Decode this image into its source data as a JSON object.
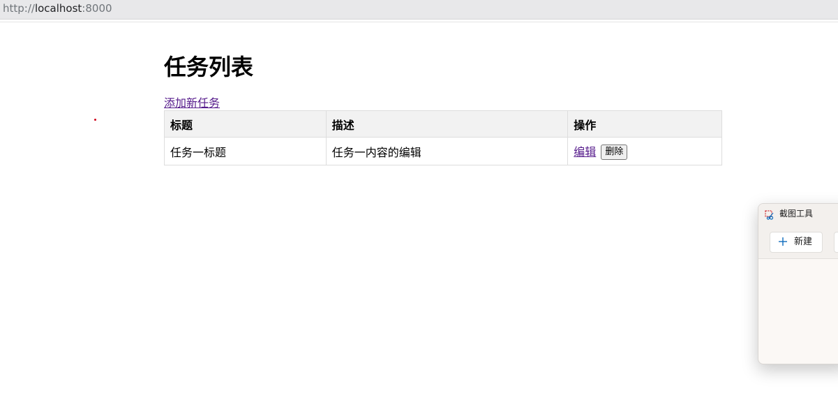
{
  "browser": {
    "url_scheme": "http://",
    "url_host": "localhost",
    "url_port": ":8000"
  },
  "page": {
    "title": "任务列表",
    "add_link": "添加新任务",
    "table": {
      "headers": [
        "标题",
        "描述",
        "操作"
      ],
      "rows": [
        {
          "title": "任务一标题",
          "description": "任务一内容的编辑",
          "edit_label": "编辑",
          "delete_label": "删除"
        }
      ]
    }
  },
  "snipping_tool": {
    "title": "截图工具",
    "new_label": "新建",
    "icons": {
      "app": "snipping-tool-icon",
      "new": "plus-icon"
    }
  },
  "colors": {
    "link_visited": "#551a8b",
    "table_header_bg": "#f2f2f2",
    "snip_accent": "#0f6cbd"
  }
}
